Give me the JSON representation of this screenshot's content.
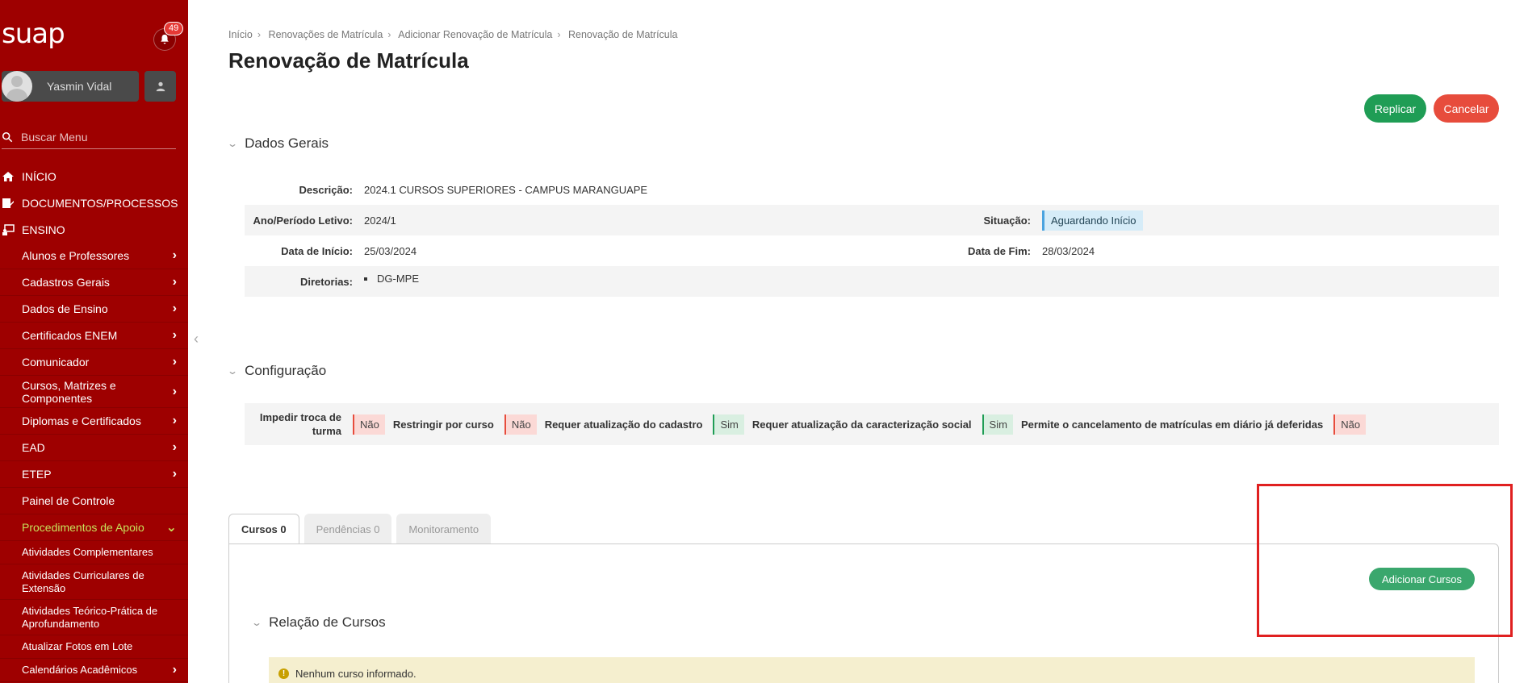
{
  "sidebar": {
    "logo": "suap",
    "notifications_count": "49",
    "username": "Yasmin Vidal",
    "search_placeholder": "Buscar Menu",
    "top_items": [
      {
        "label": "INÍCIO",
        "icon": "home-icon"
      },
      {
        "label": "DOCUMENTOS/PROCESSOS",
        "icon": "documents-icon"
      },
      {
        "label": "ENSINO",
        "icon": "teaching-icon"
      }
    ],
    "ensino_items": [
      "Alunos e Professores",
      "Cadastros Gerais",
      "Dados de Ensino",
      "Certificados ENEM",
      "Comunicador",
      "Cursos, Matrizes e Componentes",
      "Diplomas e Certificados",
      "EAD",
      "ETEP",
      "Painel de Controle",
      "Procedimentos de Apoio"
    ],
    "apoio_items": [
      "Atividades Complementares",
      "Atividades Curriculares de Extensão",
      "Atividades Teórico-Prática de Aprofundamento",
      "Atualizar Fotos em Lote",
      "Calendários Acadêmicos"
    ]
  },
  "breadcrumb": [
    "Início",
    "Renovações de Matrícula",
    "Adicionar Renovação de Matrícula",
    "Renovação de Matrícula"
  ],
  "page_title": "Renovação de Matrícula",
  "actions": {
    "replicar": "Replicar",
    "cancelar": "Cancelar"
  },
  "dados_gerais": {
    "heading": "Dados Gerais",
    "descricao_label": "Descrição:",
    "descricao": "2024.1 CURSOS SUPERIORES - CAMPUS MARANGUAPE",
    "ano_label": "Ano/Período Letivo:",
    "ano": "2024/1",
    "situacao_label": "Situação:",
    "situacao": "Aguardando Início",
    "inicio_label": "Data de Início:",
    "inicio": "25/03/2024",
    "fim_label": "Data de Fim:",
    "fim": "28/03/2024",
    "diretorias_label": "Diretorias:",
    "diretorias": [
      "DG-MPE"
    ]
  },
  "configuracao": {
    "heading": "Configuração",
    "items": [
      {
        "label": "Impedir troca de turma",
        "value": "Não"
      },
      {
        "label": "Restringir por curso",
        "value": "Não"
      },
      {
        "label": "Requer atualização do cadastro",
        "value": "Sim"
      },
      {
        "label": "Requer atualização da caracterização social",
        "value": "Sim"
      },
      {
        "label": "Permite o cancelamento de matrículas em diário já deferidas",
        "value": "Não"
      }
    ]
  },
  "tabs": [
    "Cursos 0",
    "Pendências 0",
    "Monitoramento"
  ],
  "cursos": {
    "add_button": "Adicionar Cursos",
    "heading": "Relação de Cursos",
    "empty_message": "Nenhum curso informado."
  },
  "colors": {
    "sidebar": "#9e0000",
    "success": "#1f9d55",
    "danger": "#e74c3c",
    "highlight": "#e02020"
  }
}
